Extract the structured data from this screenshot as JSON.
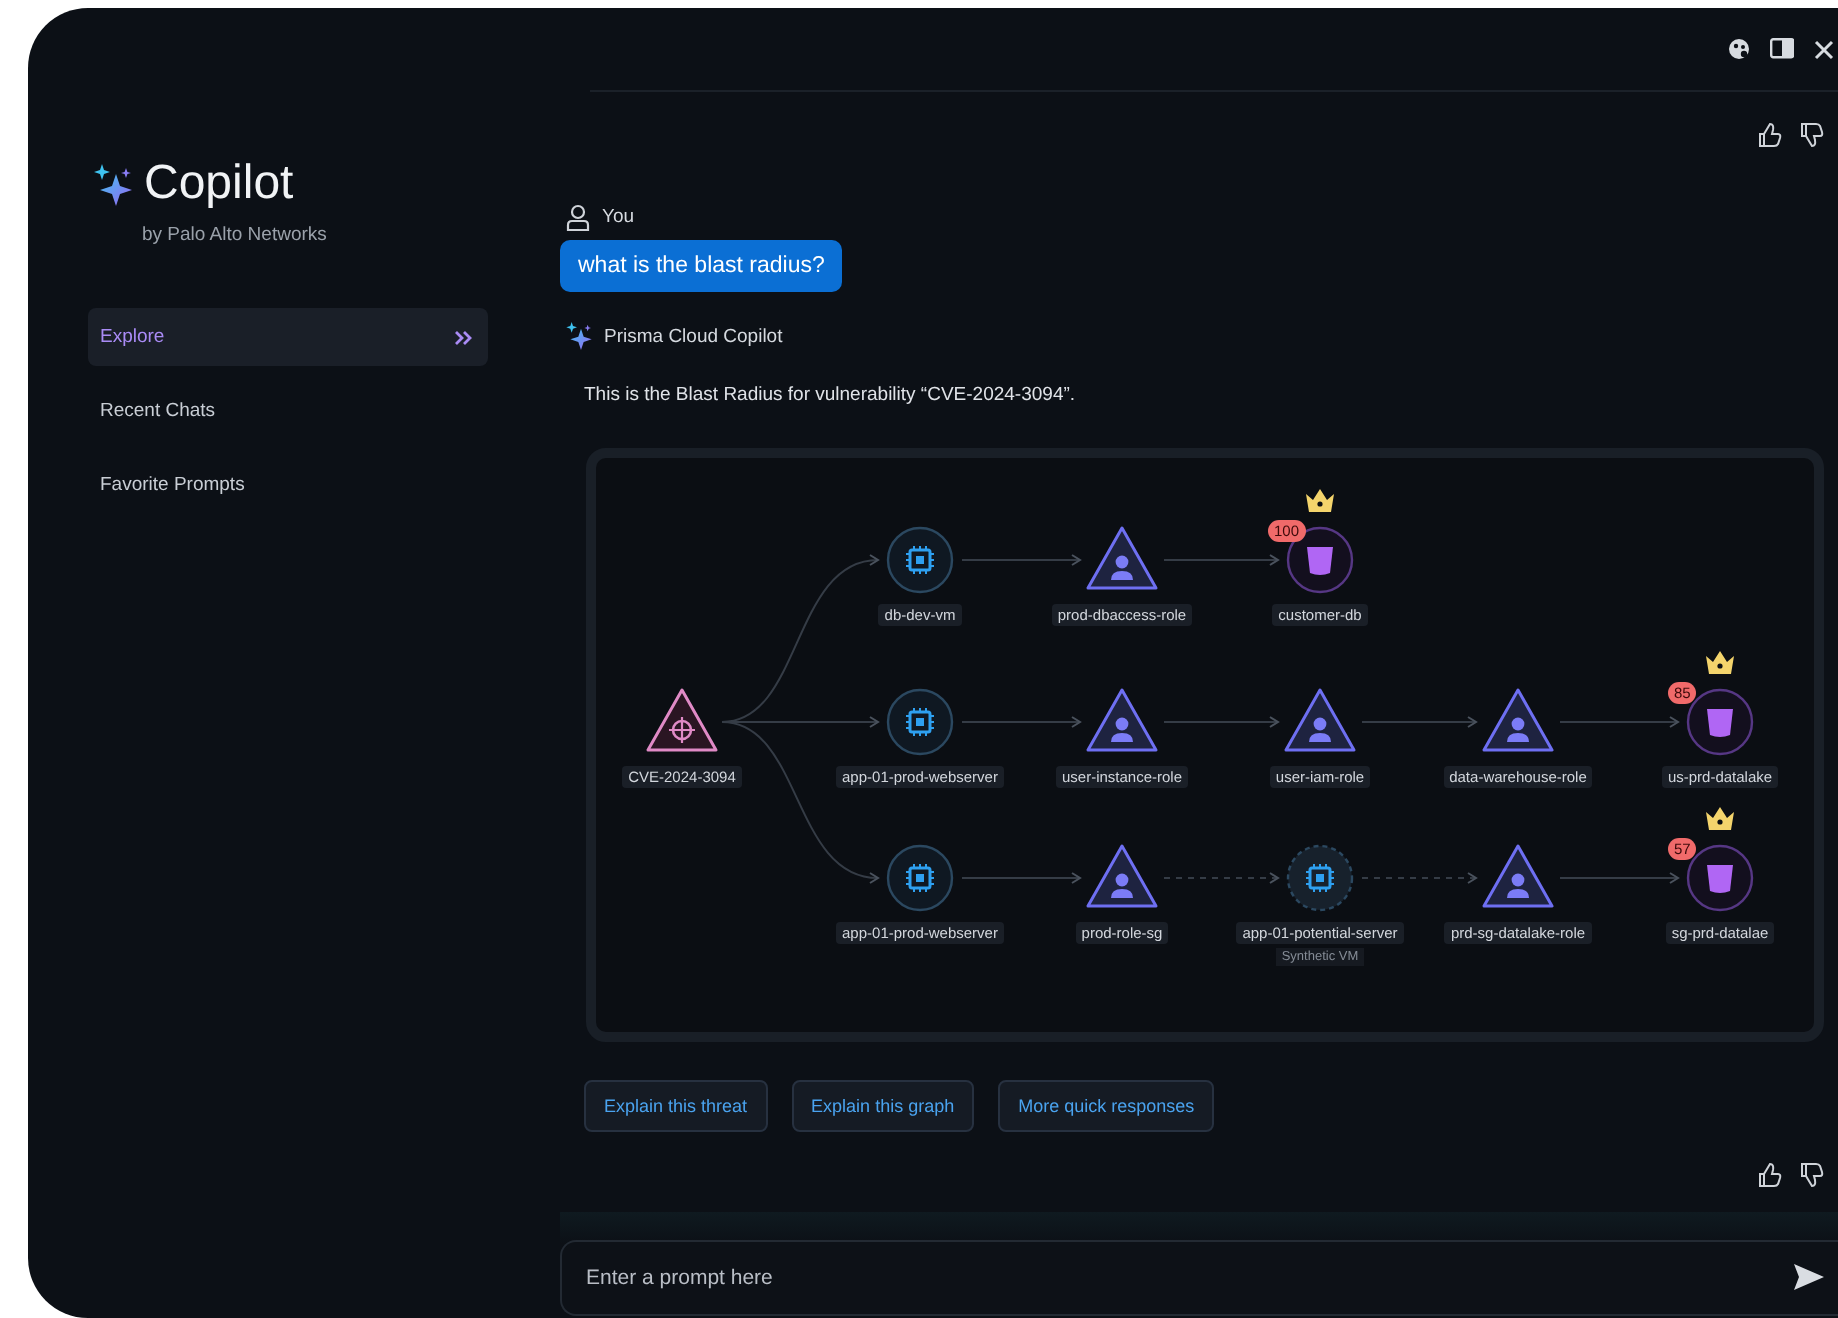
{
  "sidebar": {
    "app_name": "Copilot",
    "byline": "by Palo Alto Networks",
    "items": [
      {
        "label": "Explore",
        "selected": true
      },
      {
        "label": "Recent Chats",
        "selected": false
      },
      {
        "label": "Favorite Prompts",
        "selected": false
      }
    ]
  },
  "conversation": {
    "user_name": "You",
    "user_message": "what is the blast radius?",
    "assistant_name": "Prisma Cloud Copilot",
    "assistant_message": "This is the Blast Radius for vulnerability “CVE-2024-3094”."
  },
  "graph": {
    "root": {
      "kind": "vulnerability",
      "label": "CVE-2024-3094"
    },
    "paths": [
      [
        {
          "kind": "vm",
          "label": "db-dev-vm"
        },
        {
          "kind": "role",
          "label": "prod-dbaccess-role"
        },
        {
          "kind": "database",
          "label": "customer-db",
          "badge": "100",
          "crown": true
        }
      ],
      [
        {
          "kind": "vm",
          "label": "app-01-prod-webserver"
        },
        {
          "kind": "role",
          "label": "user-instance-role"
        },
        {
          "kind": "role",
          "label": "user-iam-role"
        },
        {
          "kind": "role",
          "label": "data-warehouse-role"
        },
        {
          "kind": "database",
          "label": "us-prd-datalake",
          "badge": "85",
          "crown": true
        }
      ],
      [
        {
          "kind": "vm",
          "label": "app-01-prod-webserver"
        },
        {
          "kind": "role",
          "label": "prod-role-sg"
        },
        {
          "kind": "vm",
          "label": "app-01-potential-server",
          "synthetic": true,
          "sublabel": "Synthetic VM"
        },
        {
          "kind": "role",
          "label": "prd-sg-datalake-role"
        },
        {
          "kind": "database",
          "label": "sg-prd-datalae",
          "badge": "57",
          "crown": true
        }
      ]
    ]
  },
  "quick_responses": [
    "Explain this threat",
    "Explain this graph",
    "More quick responses"
  ],
  "prompt": {
    "placeholder": "Enter a prompt here"
  }
}
